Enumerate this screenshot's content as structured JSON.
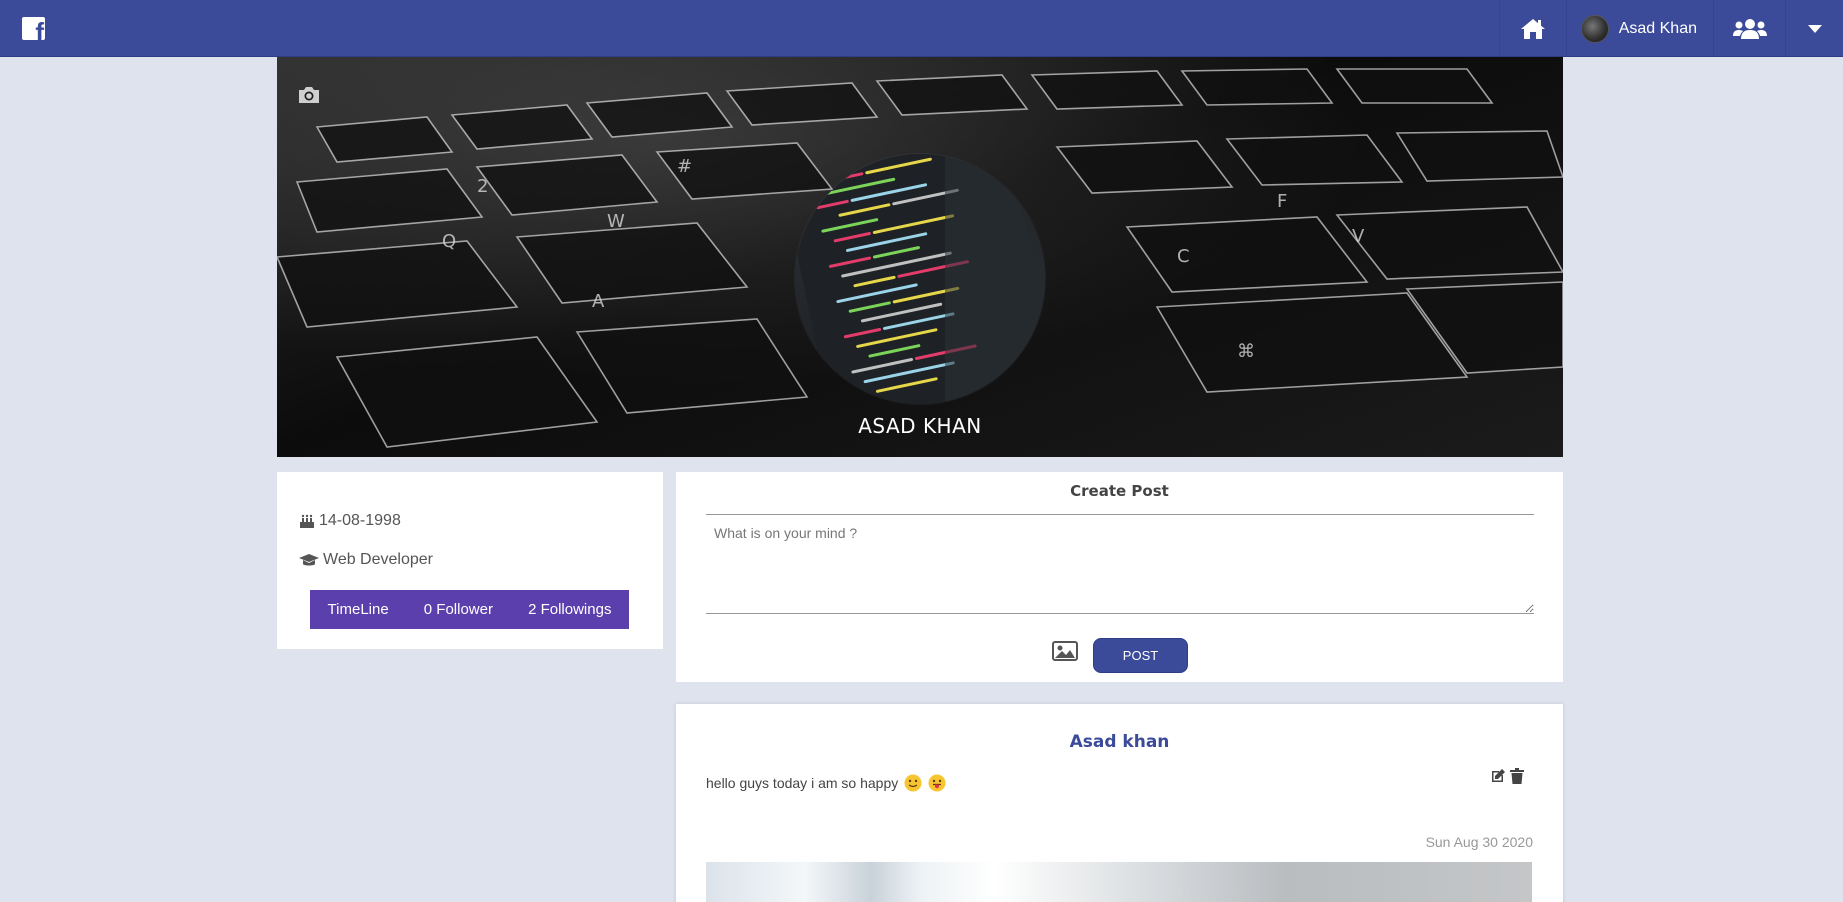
{
  "topbar": {
    "logo_letter": "f",
    "user_name": "Asad Khan",
    "brand_color": "#3b4a99",
    "icons": [
      "facebook-logo-icon",
      "home-icon",
      "avatar",
      "friends-icon",
      "caret-down-icon"
    ]
  },
  "cover": {
    "name": "ASAD KHAN",
    "icons": [
      "camera-icon"
    ]
  },
  "info": {
    "dob": "14-08-1998",
    "job": "Web Developer",
    "icons": [
      "birthday-cake-icon",
      "graduation-cap-icon"
    ],
    "tabs": {
      "timeline": "TimeLine",
      "followers": "0 Follower",
      "followings": "2 Followings"
    },
    "tab_color": "#5b3fad"
  },
  "create_post": {
    "title": "Create Post",
    "placeholder": "What is on your mind ?",
    "post_button": "POST",
    "icons": [
      "image-icon"
    ]
  },
  "post": {
    "author": "Asad khan",
    "text": "hello guys today i am so happy",
    "date": "Sun Aug 30 2020",
    "icons": [
      "edit-icon",
      "trash-icon",
      "smiley-emoji-icon",
      "tongue-emoji-icon"
    ]
  }
}
